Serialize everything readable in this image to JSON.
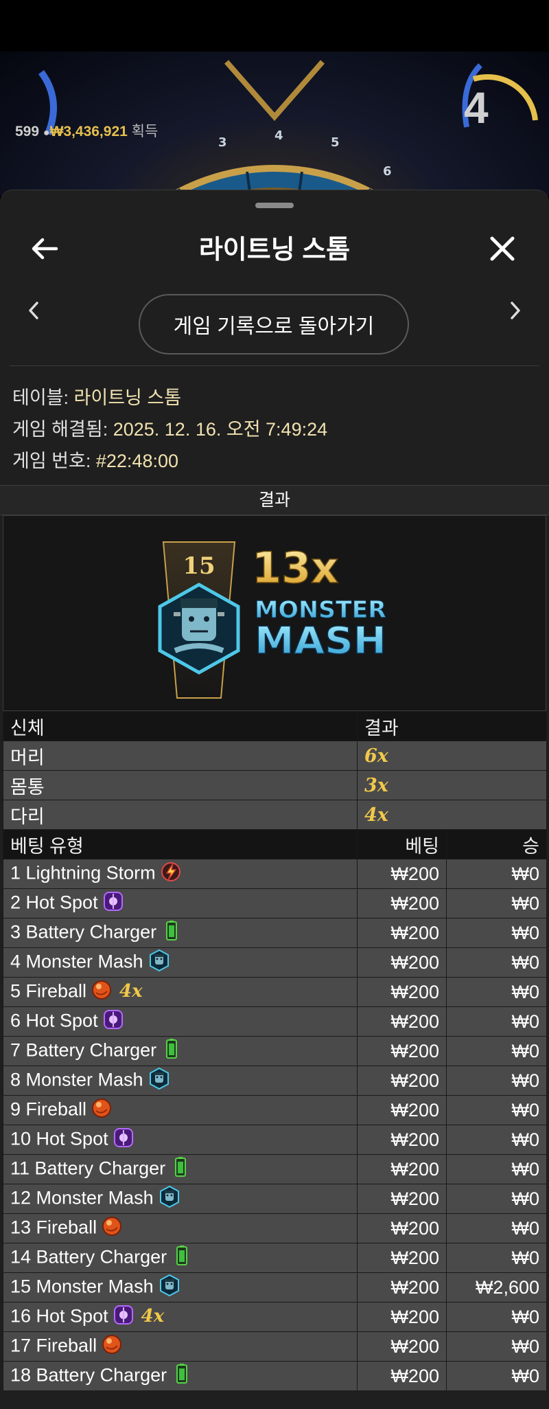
{
  "stream": {
    "players": "599",
    "amount": "₩3,436,921",
    "amount_suffix": "획득",
    "countdown": "4",
    "wheel_numbers": [
      "3",
      "4",
      "5",
      "6"
    ]
  },
  "header": {
    "title": "라이트닝 스톰",
    "back_to_history": "게임 기록으로 돌아가기"
  },
  "info": {
    "table_label": "테이블: ",
    "table_value": "라이트닝 스톰",
    "resolved_label": "게임 해결됨: ",
    "resolved_value": "2025. 12. 16. 오전 7:49:24",
    "game_no_label": "게임 번호: ",
    "game_no_value": "#22:48:00"
  },
  "result": {
    "section_title": "결과",
    "segment_number": "15",
    "multiplier": "13x",
    "name_line1": "MONSTER",
    "name_line2": "MASH"
  },
  "body_table": {
    "col_part": "신체",
    "col_result": "결과",
    "rows": [
      {
        "part": "머리",
        "mult": "6x"
      },
      {
        "part": "몸통",
        "mult": "3x"
      },
      {
        "part": "다리",
        "mult": "4x"
      }
    ]
  },
  "bets_table": {
    "col_type": "베팅 유형",
    "col_bet": "베팅",
    "col_win": "승",
    "rows": [
      {
        "label": "1 Lightning Storm",
        "icon": "lightning-storm-icon",
        "extra": "",
        "bet": "₩200",
        "win": "₩0"
      },
      {
        "label": "2 Hot Spot",
        "icon": "hot-spot-icon",
        "extra": "",
        "bet": "₩200",
        "win": "₩0"
      },
      {
        "label": "3 Battery Charger",
        "icon": "battery-charger-icon",
        "extra": "",
        "bet": "₩200",
        "win": "₩0"
      },
      {
        "label": "4 Monster Mash",
        "icon": "monster-mash-icon",
        "extra": "",
        "bet": "₩200",
        "win": "₩0"
      },
      {
        "label": "5 Fireball",
        "icon": "fireball-icon",
        "extra": "4x",
        "bet": "₩200",
        "win": "₩0"
      },
      {
        "label": "6 Hot Spot",
        "icon": "hot-spot-icon",
        "extra": "",
        "bet": "₩200",
        "win": "₩0"
      },
      {
        "label": "7 Battery Charger",
        "icon": "battery-charger-icon",
        "extra": "",
        "bet": "₩200",
        "win": "₩0"
      },
      {
        "label": "8 Monster Mash",
        "icon": "monster-mash-icon",
        "extra": "",
        "bet": "₩200",
        "win": "₩0"
      },
      {
        "label": "9 Fireball",
        "icon": "fireball-icon",
        "extra": "",
        "bet": "₩200",
        "win": "₩0"
      },
      {
        "label": "10 Hot Spot",
        "icon": "hot-spot-icon",
        "extra": "",
        "bet": "₩200",
        "win": "₩0"
      },
      {
        "label": "11 Battery Charger",
        "icon": "battery-charger-icon",
        "extra": "",
        "bet": "₩200",
        "win": "₩0"
      },
      {
        "label": "12 Monster Mash",
        "icon": "monster-mash-icon",
        "extra": "",
        "bet": "₩200",
        "win": "₩0"
      },
      {
        "label": "13 Fireball",
        "icon": "fireball-icon",
        "extra": "",
        "bet": "₩200",
        "win": "₩0"
      },
      {
        "label": "14 Battery Charger",
        "icon": "battery-charger-icon",
        "extra": "",
        "bet": "₩200",
        "win": "₩0"
      },
      {
        "label": "15 Monster Mash",
        "icon": "monster-mash-icon",
        "extra": "",
        "bet": "₩200",
        "win": "₩2,600"
      },
      {
        "label": "16 Hot Spot",
        "icon": "hot-spot-icon",
        "extra": "4x",
        "bet": "₩200",
        "win": "₩0"
      },
      {
        "label": "17 Fireball",
        "icon": "fireball-icon",
        "extra": "",
        "bet": "₩200",
        "win": "₩0"
      },
      {
        "label": "18 Battery Charger",
        "icon": "battery-charger-icon",
        "extra": "",
        "bet": "₩200",
        "win": "₩0"
      }
    ]
  },
  "colors": {
    "gold": "#f1c84a",
    "info_value": "#f2e2b0",
    "row_bg": "#4a4a4a",
    "header_bg": "#141414"
  }
}
